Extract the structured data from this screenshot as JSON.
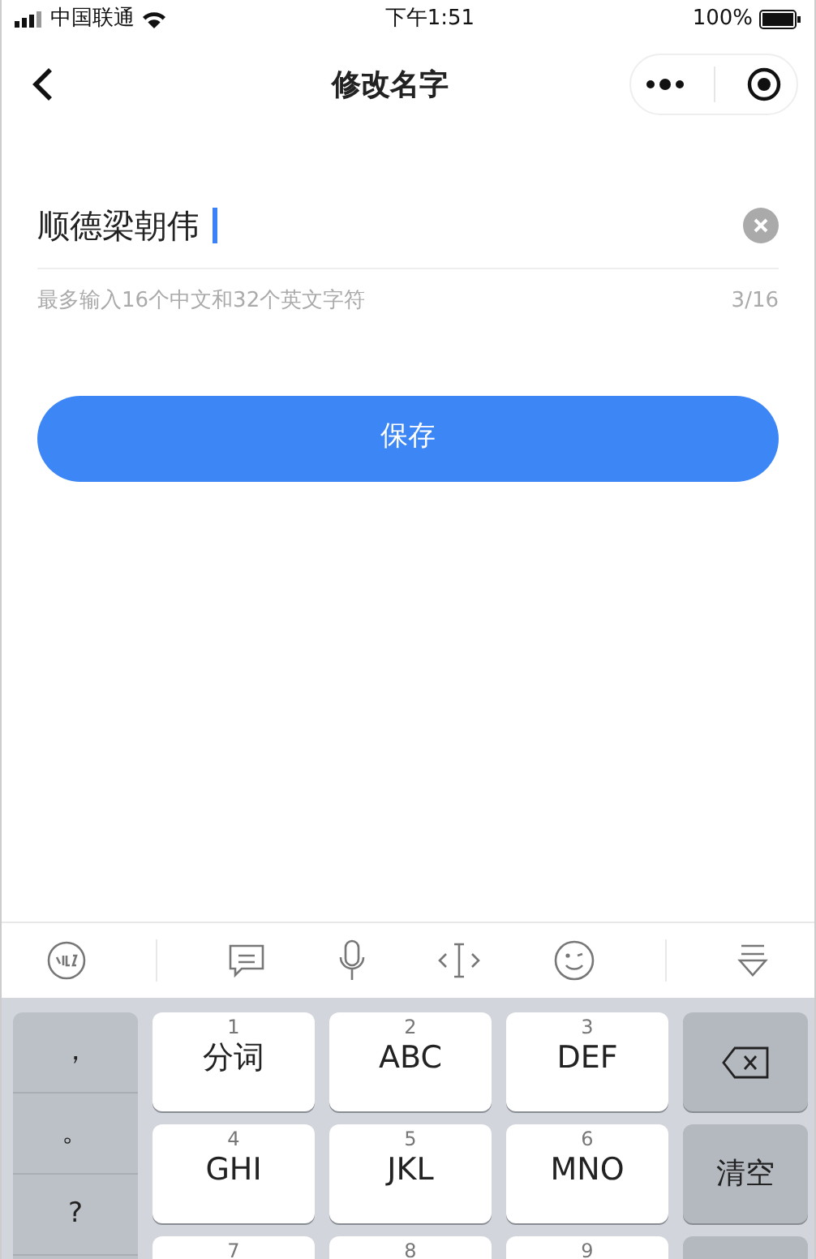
{
  "status_bar": {
    "carrier": "中国联通",
    "time": "下午1:51",
    "battery": "100%"
  },
  "nav": {
    "title": "修改名字"
  },
  "name_field": {
    "value": "顺德梁朝伟"
  },
  "hint": "最多输入16个中文和32个英文字符",
  "counter": "3/16",
  "save_button": "保存",
  "keyboard": {
    "left_keys": [
      "，",
      "。",
      "?"
    ],
    "keys": [
      {
        "digit": "1",
        "label": "分词"
      },
      {
        "digit": "2",
        "label": "ABC"
      },
      {
        "digit": "3",
        "label": "DEF"
      },
      {
        "digit": "4",
        "label": "GHI"
      },
      {
        "digit": "5",
        "label": "JKL"
      },
      {
        "digit": "6",
        "label": "MNO"
      },
      {
        "digit": "7"
      },
      {
        "digit": "8"
      },
      {
        "digit": "9"
      }
    ],
    "right_keys": [
      {
        "kind": "delete"
      },
      {
        "kind": "text",
        "label": "清空"
      },
      {
        "kind": "blank"
      }
    ]
  }
}
